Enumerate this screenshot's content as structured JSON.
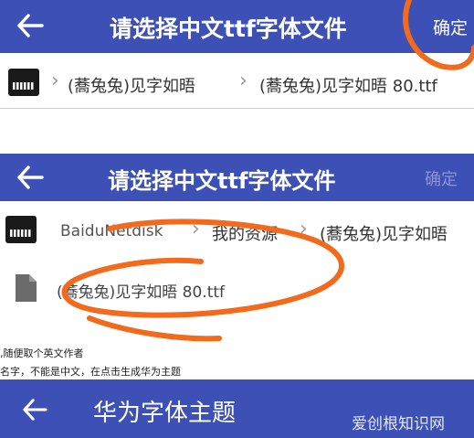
{
  "screen1": {
    "title": "请选择中文ttf字体文件",
    "confirm": "确定",
    "breadcrumb": [
      "(蕎兔兔)见字如晤",
      "(蕎兔兔)见字如晤 80.ttf"
    ]
  },
  "screen2": {
    "title": "请选择中文ttf字体文件",
    "confirm": "确定",
    "breadcrumb": [
      "BaiduNetdisk",
      "我的资源",
      "(蕎兔兔)见字如晤"
    ],
    "file_name": "(蕎兔兔)见字如晤 80.ttf"
  },
  "notes": [
    ",随便取个英文作者",
    "名字，不能是中文，在点击生成华为主题"
  ],
  "screen3": {
    "title": "华为字体主题"
  },
  "watermark": "爱创根知识网",
  "colors": {
    "appbar": "#3d50b5",
    "annotation": "#f26a1b",
    "confirm_disabled": "#8a94d4"
  }
}
